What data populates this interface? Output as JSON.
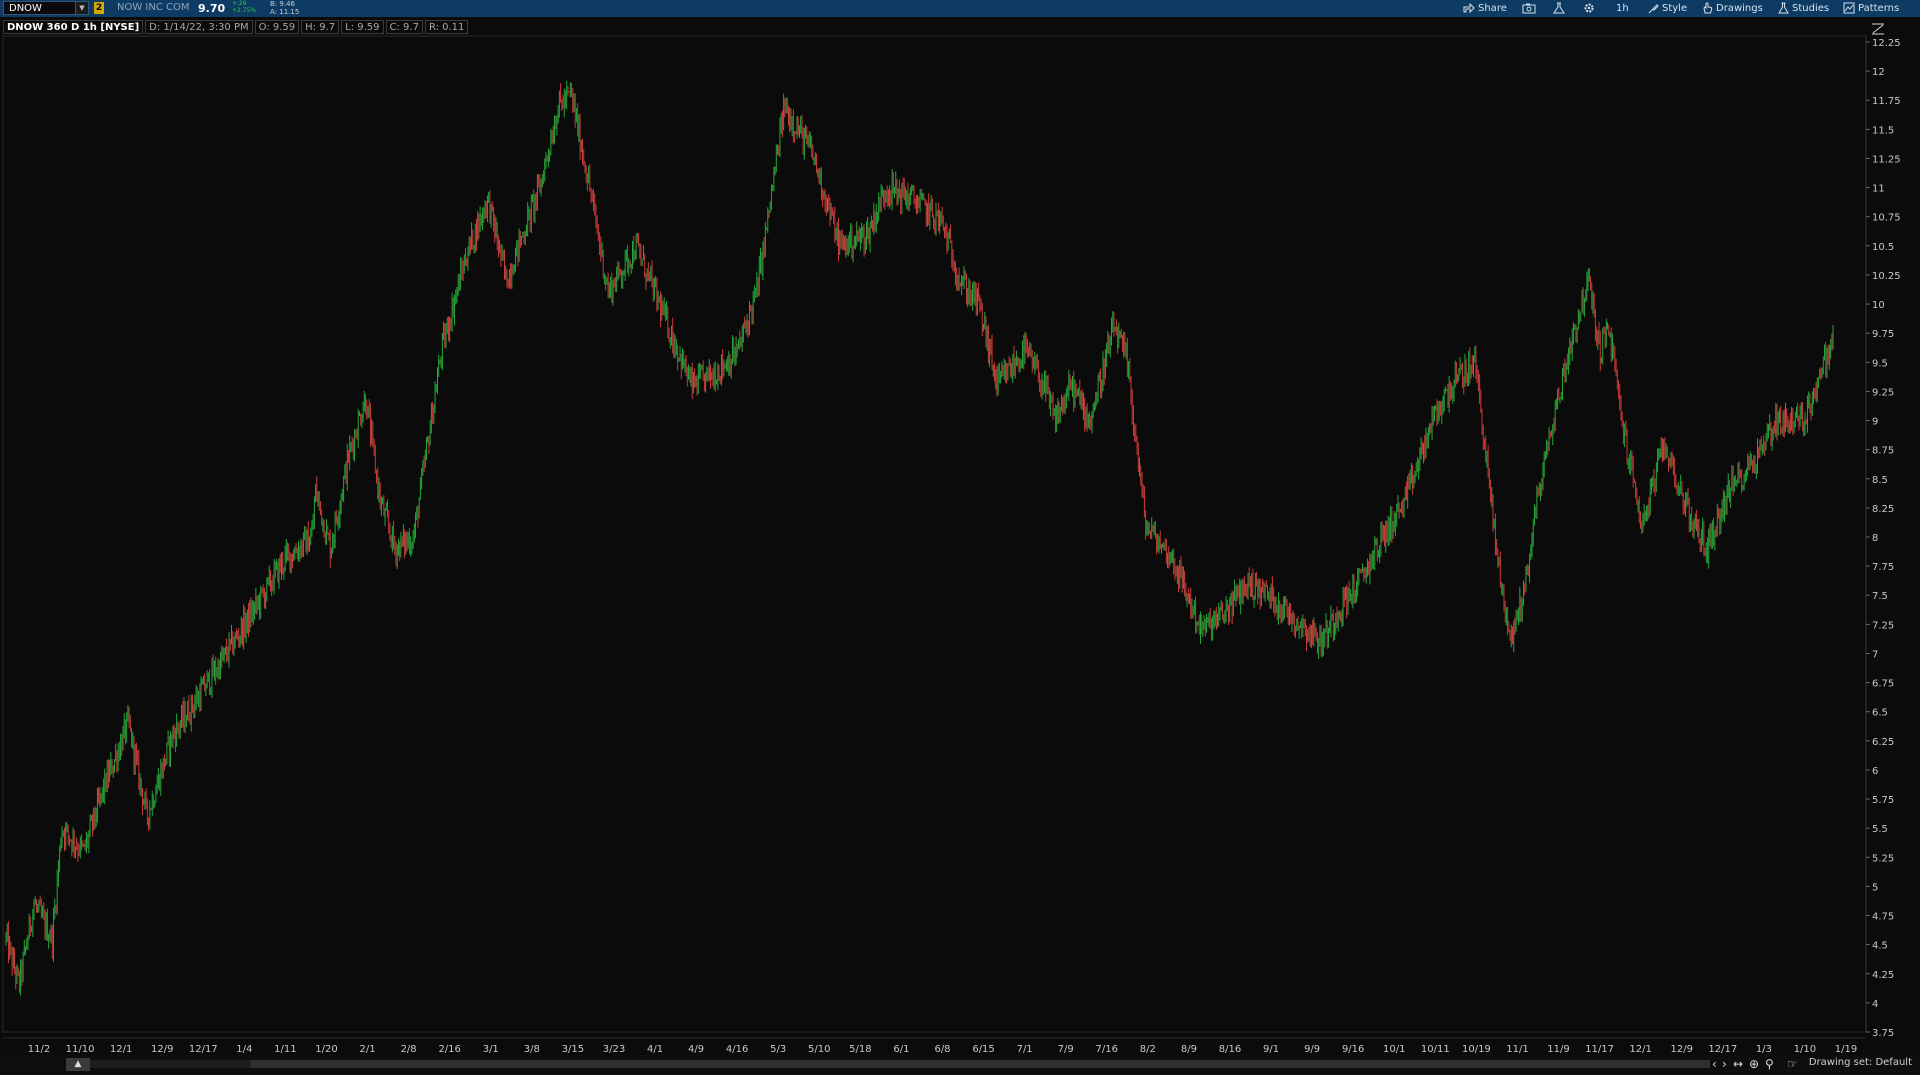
{
  "header": {
    "symbol": "DNOW",
    "link_badge": "2",
    "company": "NOW INC COM",
    "last": "9.70",
    "change_abs": "+.26",
    "change_pct": "+2.75%",
    "bid": "B: 9.46",
    "ask": "A: 11.15"
  },
  "toolbar": {
    "share": "Share",
    "timeframe": "1h",
    "style": "Style",
    "drawings": "Drawings",
    "studies": "Studies",
    "patterns": "Patterns"
  },
  "infobar": {
    "title": "DNOW 360 D 1h [NYSE]",
    "date": "D: 1/14/22, 3:30 PM",
    "open": "O: 9.59",
    "high": "H: 9.7",
    "low": "L: 9.59",
    "close": "C: 9.7",
    "range": "R: 0.11"
  },
  "status": {
    "drawing_set": "Drawing set: Default"
  },
  "colors": {
    "up": "#25a83a",
    "down": "#cc3b3b",
    "background": "#0b0b0b",
    "header": "#0d3b63"
  },
  "chart_data": {
    "type": "candlestick",
    "symbol": "DNOW",
    "ylim": [
      3.75,
      12.25
    ],
    "y_ticks": [
      "12.25",
      "12",
      "11.75",
      "11.5",
      "11.25",
      "11",
      "10.75",
      "10.5",
      "10.25",
      "10",
      "9.75",
      "9.5",
      "9.25",
      "9",
      "8.75",
      "8.5",
      "8.25",
      "8",
      "7.75",
      "7.5",
      "7.25",
      "7",
      "6.75",
      "6.5",
      "6.25",
      "6",
      "5.75",
      "5.5",
      "5.25",
      "5",
      "4.75",
      "4.5",
      "4.25",
      "4",
      "3.75"
    ],
    "x_ticks": [
      "11/2",
      "11/10",
      "12/1",
      "12/9",
      "12/17",
      "1/4",
      "1/11",
      "1/20",
      "2/1",
      "2/8",
      "2/16",
      "3/1",
      "3/8",
      "3/15",
      "3/23",
      "4/1",
      "4/9",
      "4/16",
      "5/3",
      "5/10",
      "5/18",
      "6/1",
      "6/8",
      "6/15",
      "7/1",
      "7/9",
      "7/16",
      "8/2",
      "8/9",
      "8/16",
      "9/1",
      "9/9",
      "9/16",
      "10/1",
      "10/11",
      "10/19",
      "11/1",
      "11/9",
      "11/17",
      "12/1",
      "12/9",
      "12/17",
      "1/3",
      "1/10",
      "1/19"
    ],
    "price_path": [
      [
        0,
        4.55
      ],
      [
        0.7,
        4.15
      ],
      [
        1.5,
        4.85
      ],
      [
        2.5,
        4.55
      ],
      [
        3,
        5.5
      ],
      [
        4.2,
        5.3
      ],
      [
        5.4,
        5.9
      ],
      [
        6.6,
        6.4
      ],
      [
        7.6,
        5.6
      ],
      [
        9,
        6.3
      ],
      [
        11.5,
        6.9
      ],
      [
        13.5,
        7.4
      ],
      [
        15,
        7.8
      ],
      [
        16.5,
        8.0
      ],
      [
        16.7,
        8.4
      ],
      [
        17.5,
        7.9
      ],
      [
        18.5,
        8.7
      ],
      [
        19.4,
        9.2
      ],
      [
        20.2,
        8.3
      ],
      [
        21,
        7.9
      ],
      [
        22,
        8.0
      ],
      [
        23.5,
        9.6
      ],
      [
        24.8,
        10.4
      ],
      [
        26,
        10.9
      ],
      [
        27,
        10.2
      ],
      [
        28.8,
        11.0
      ],
      [
        29.8,
        11.7
      ],
      [
        30.5,
        11.8
      ],
      [
        31.5,
        11.0
      ],
      [
        32.5,
        10.1
      ],
      [
        34,
        10.5
      ],
      [
        35.5,
        9.9
      ],
      [
        37,
        9.3
      ],
      [
        38.2,
        9.4
      ],
      [
        39.5,
        9.6
      ],
      [
        40.5,
        10.1
      ],
      [
        41,
        10.6
      ],
      [
        42,
        11.7
      ],
      [
        43.5,
        11.3
      ],
      [
        45,
        10.5
      ],
      [
        46.5,
        10.6
      ],
      [
        47.5,
        11.0
      ],
      [
        49,
        10.9
      ],
      [
        50.5,
        10.7
      ],
      [
        51.5,
        10.2
      ],
      [
        52.5,
        10.0
      ],
      [
        53.5,
        9.3
      ],
      [
        55,
        9.6
      ],
      [
        56,
        9.3
      ],
      [
        56.6,
        9.0
      ],
      [
        57.5,
        9.3
      ],
      [
        58.5,
        9.0
      ],
      [
        59.8,
        9.8
      ],
      [
        60.5,
        9.5
      ],
      [
        61.5,
        8.1
      ],
      [
        63,
        7.8
      ],
      [
        64.5,
        7.2
      ],
      [
        65.5,
        7.3
      ],
      [
        67,
        7.6
      ],
      [
        68.2,
        7.5
      ],
      [
        69.5,
        7.3
      ],
      [
        71,
        7.1
      ],
      [
        72,
        7.4
      ],
      [
        73,
        7.6
      ],
      [
        74.3,
        8.0
      ],
      [
        75.5,
        8.3
      ],
      [
        77,
        9.0
      ],
      [
        78,
        9.3
      ],
      [
        79.3,
        9.5
      ],
      [
        80.5,
        7.8
      ],
      [
        81.2,
        7.1
      ],
      [
        82,
        7.6
      ],
      [
        82.6,
        8.3
      ],
      [
        83.5,
        9.0
      ],
      [
        84.5,
        9.7
      ],
      [
        85.4,
        10.2
      ],
      [
        86,
        9.6
      ],
      [
        86.5,
        9.8
      ],
      [
        87.3,
        8.9
      ],
      [
        88.3,
        8.1
      ],
      [
        89.5,
        8.8
      ],
      [
        90.8,
        8.2
      ],
      [
        91.8,
        7.9
      ],
      [
        93,
        8.4
      ],
      [
        94.5,
        8.7
      ],
      [
        95.5,
        9.0
      ],
      [
        97,
        9.0
      ],
      [
        98.6,
        9.7
      ]
    ]
  }
}
